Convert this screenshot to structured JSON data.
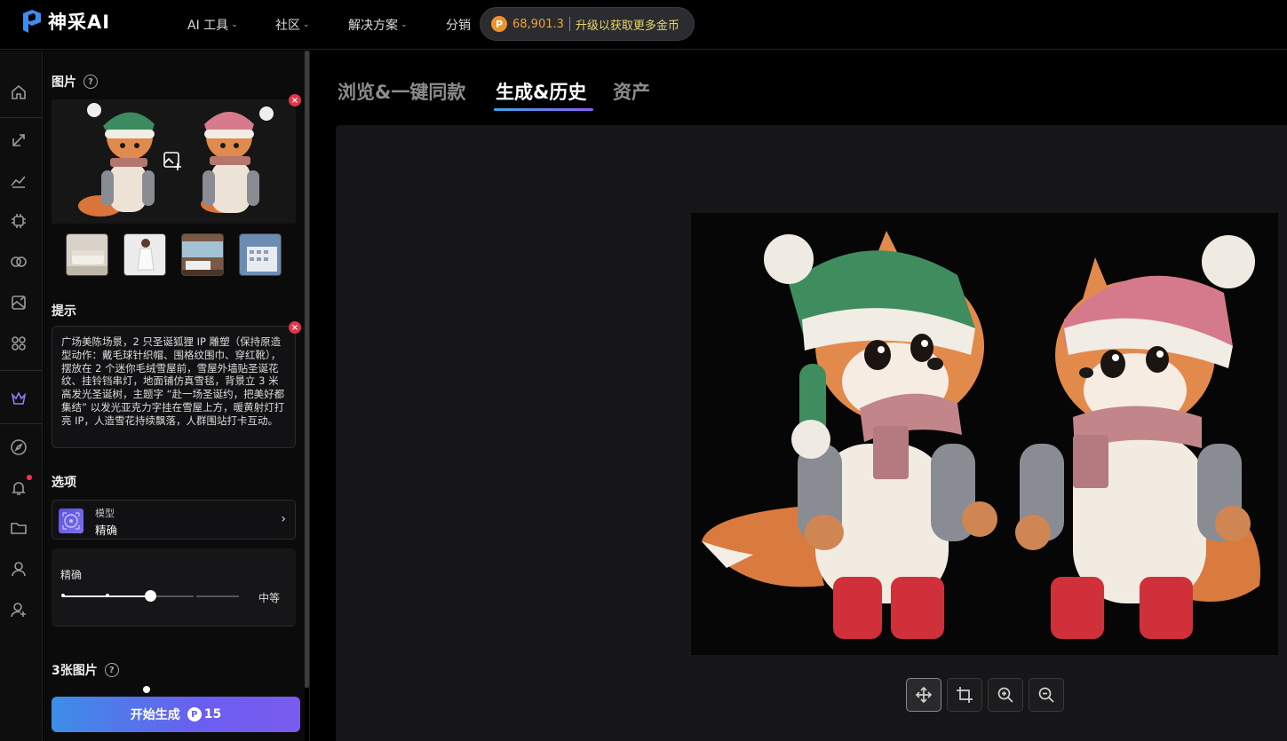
{
  "header": {
    "logo_text": "神采AI",
    "nav": [
      {
        "label": "AI 工具"
      },
      {
        "label": "社区"
      },
      {
        "label": "解决方案"
      },
      {
        "label": "分销"
      }
    ],
    "coins": "68,901.3",
    "upgrade_label": "升级以获取更多金币",
    "coin_symbol": "P"
  },
  "rail": {
    "items": [
      "home-icon",
      "edit-icon",
      "chart-icon",
      "chip-icon",
      "rings-icon",
      "gallery-icon",
      "apps-icon",
      "crown-icon",
      "compass-icon",
      "bell-icon",
      "folder-icon",
      "user-icon",
      "user-add-icon"
    ],
    "active": "crown-icon",
    "accent": "#8b7df5"
  },
  "panel": {
    "image_label": "图片",
    "prompt_label": "提示",
    "prompt_text": "广场美陈场景，2 只圣诞狐狸 IP 雕塑（保持原造型动作：戴毛球针织帽、围格纹围巾、穿红靴），摆放在 2 个迷你毛绒雪屋前，雪屋外墙贴圣诞花纹、挂铃铛串灯，地面铺仿真雪毯，背景立 3 米高发光圣诞树，主题字 “赴一场圣诞约，把美好都集结” 以发光亚克力字挂在雪屋上方，暖黄射灯打亮 IP，人造雪花持续飘落，人群围站打卡互动。",
    "options_label": "选项",
    "model_label": "模型",
    "model_value": "精确",
    "precision_label": "精确",
    "precision_value_label": "中等",
    "precision_level": 0.5,
    "count_label": "3张图片",
    "generate_label": "开始生成",
    "generate_cost": "15"
  },
  "main": {
    "tabs": [
      {
        "label": "浏览&一键同款",
        "active": false
      },
      {
        "label": "生成&历史",
        "active": true
      },
      {
        "label": "资产",
        "active": false
      }
    ],
    "toolbar": [
      "move-icon",
      "crop-icon",
      "zoom-in-icon",
      "zoom-out-icon"
    ]
  },
  "colors": {
    "accent_start": "#3d8ee6",
    "accent_end": "#7a5bef",
    "coin": "#f0922a",
    "badge_red": "#e5334b"
  }
}
